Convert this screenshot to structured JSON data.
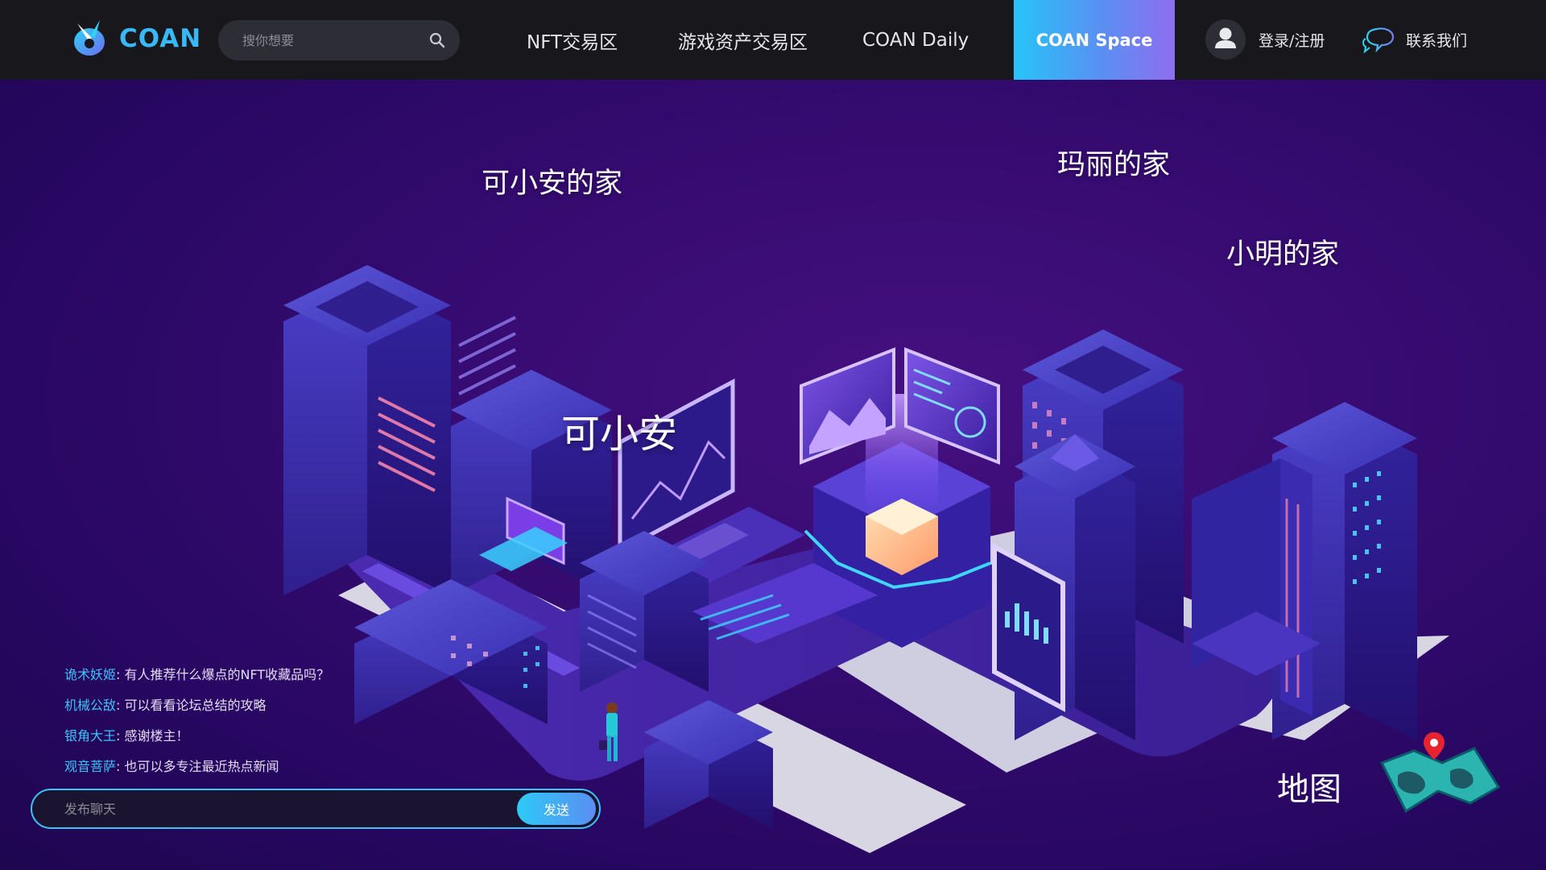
{
  "header": {
    "brand": "COAN",
    "search": {
      "placeholder": "搜你想要"
    },
    "nav": [
      {
        "label": "NFT交易区"
      },
      {
        "label": "游戏资产交易区"
      },
      {
        "label": "COAN Daily"
      },
      {
        "label": "COAN Space",
        "active": true
      }
    ],
    "login_label": "登录/注册",
    "contact_label": "联系我们"
  },
  "scene": {
    "homes": [
      {
        "label": "可小安的家"
      },
      {
        "label": "玛丽的家"
      },
      {
        "label": "小明的家"
      }
    ],
    "avatar_name": "可小安",
    "map_label": "地图"
  },
  "chat": {
    "messages": [
      {
        "user": "诡术妖姬",
        "text": "有人推荐什么爆点的NFT收藏品吗？"
      },
      {
        "user": "机械公敌",
        "text": "可以看看论坛总结的攻略"
      },
      {
        "user": "银角大王",
        "text": "感谢楼主！"
      },
      {
        "user": "观音菩萨",
        "text": "也可以多专注最近热点新闻"
      }
    ],
    "input_placeholder": "发布聊天",
    "send_label": "发送"
  },
  "colors": {
    "accent": "#3ec3f7",
    "header_bg": "#17171c",
    "page_bg": "#2a0a63",
    "active_gradient_start": "#27c4f8",
    "active_gradient_end": "#8f6ef0"
  },
  "icons": [
    "coan-logo-icon",
    "search-icon",
    "user-icon",
    "chat-bubble-icon",
    "map-icon",
    "location-pin-icon"
  ]
}
